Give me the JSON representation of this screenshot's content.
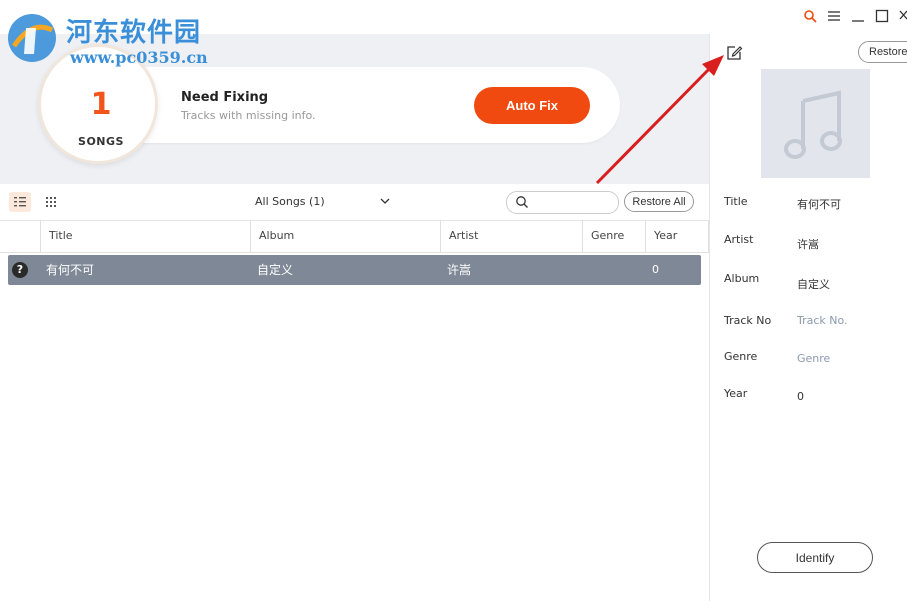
{
  "watermark": {
    "title": "河东软件园",
    "url": "www.pc0359.cn"
  },
  "titlebar": {
    "icons": [
      "search-icon",
      "menu-icon",
      "minimize-icon",
      "maximize-icon",
      "close-icon"
    ]
  },
  "summary": {
    "count": "1",
    "count_label": "SONGS",
    "title": "Need Fixing",
    "subtitle": "Tracks with missing info.",
    "auto_fix_label": "Auto Fix"
  },
  "toolbar": {
    "filter_label": "All Songs (1)",
    "search_placeholder": "",
    "restore_all_label": "Restore All"
  },
  "table": {
    "columns": [
      "Title",
      "Album",
      "Artist",
      "Genre",
      "Year"
    ],
    "rows": [
      {
        "title": "有何不可",
        "album": "自定义",
        "artist": "许嵩",
        "genre": "",
        "year": "0"
      }
    ]
  },
  "details": {
    "restore_label": "Restore",
    "fields": [
      {
        "label": "Title",
        "value": "有何不可",
        "placeholder": false
      },
      {
        "label": "Artist",
        "value": "许嵩",
        "placeholder": false
      },
      {
        "label": "Album",
        "value": "自定义",
        "placeholder": false
      },
      {
        "label": "Track No",
        "value": "Track No.",
        "placeholder": true
      },
      {
        "label": "Genre",
        "value": "Genre",
        "placeholder": true
      },
      {
        "label": "Year",
        "value": "0",
        "placeholder": false
      }
    ],
    "identify_label": "Identify"
  },
  "colors": {
    "accent": "#f04a10",
    "selected_row": "#7f8896",
    "banner_bg": "#eef0f4",
    "watermark_blue": "#3a8fd8",
    "annotation_arrow": "#d81e1e"
  }
}
